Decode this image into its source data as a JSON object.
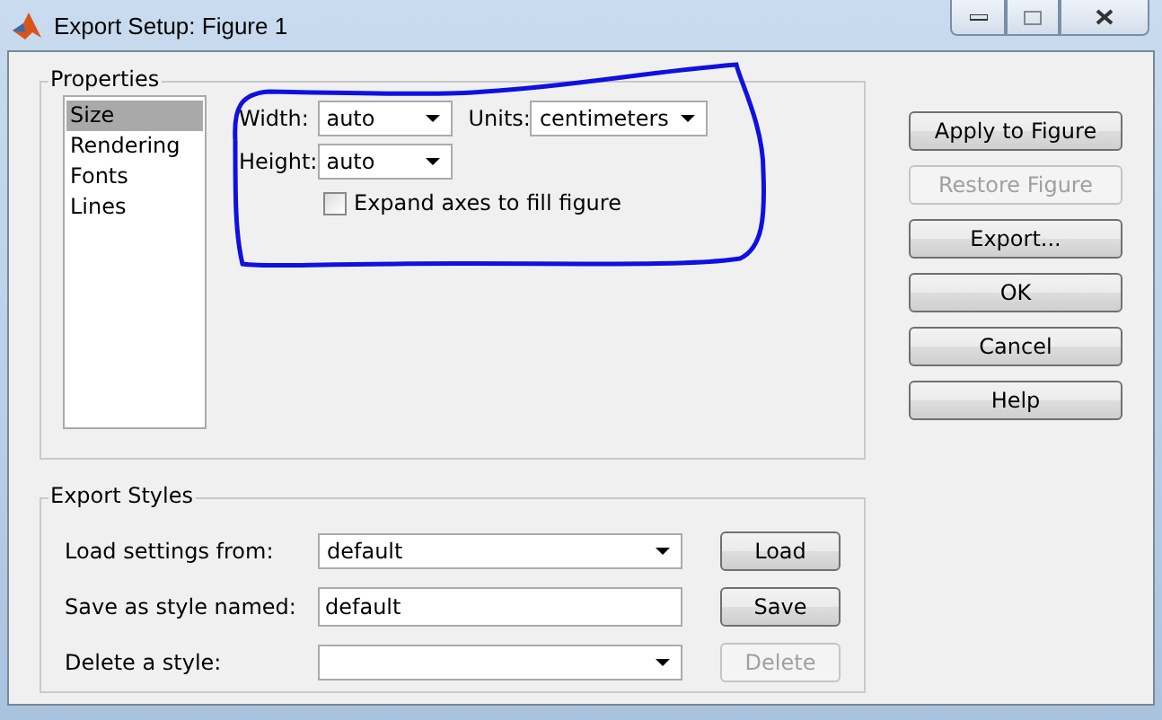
{
  "window": {
    "title": "Export Setup: Figure 1"
  },
  "properties": {
    "title": "Properties",
    "categories": [
      {
        "label": "Size",
        "selected": true
      },
      {
        "label": "Rendering",
        "selected": false
      },
      {
        "label": "Fonts",
        "selected": false
      },
      {
        "label": "Lines",
        "selected": false
      }
    ],
    "width": {
      "label": "Width:",
      "value": "auto"
    },
    "units": {
      "label": "Units:",
      "value": "centimeters"
    },
    "height": {
      "label": "Height:",
      "value": "auto"
    },
    "expand_axes": {
      "label": "Expand axes to fill figure",
      "checked": false
    }
  },
  "actions": [
    {
      "label": "Apply to Figure",
      "disabled": false
    },
    {
      "label": "Restore Figure",
      "disabled": true
    },
    {
      "label": "Export...",
      "disabled": false
    },
    {
      "label": "OK",
      "disabled": false
    },
    {
      "label": "Cancel",
      "disabled": false
    },
    {
      "label": "Help",
      "disabled": false
    }
  ],
  "export_styles": {
    "title": "Export Styles",
    "rows": [
      {
        "kind": "dropdown",
        "label": "Load settings from:",
        "value": "default",
        "button": {
          "label": "Load",
          "disabled": false
        }
      },
      {
        "kind": "text",
        "label": "Save as style named:",
        "value": "default",
        "button": {
          "label": "Save",
          "disabled": false
        }
      },
      {
        "kind": "dropdown",
        "label": "Delete a style:",
        "button": {
          "label": "Delete",
          "disabled": true
        }
      }
    ]
  }
}
